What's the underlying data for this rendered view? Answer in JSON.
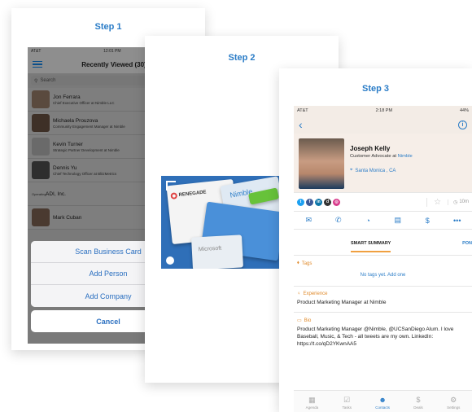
{
  "steps": {
    "step1": "Step 1",
    "step2": "Step 2",
    "step3": "Step 3"
  },
  "step1": {
    "status_carrier": "AT&T",
    "status_time": "12:01 PM",
    "title": "Recently Viewed (30)",
    "search_placeholder": "Search",
    "contacts": [
      {
        "name": "Jon Ferrara",
        "title": "Chief Executive Officer at Nimble LLC"
      },
      {
        "name": "Michaela Prouzova",
        "title": "Community Engagement Manager at Nimble"
      },
      {
        "name": "Kevin Turner",
        "title": "Strategic Partner Development at Nimble"
      },
      {
        "name": "Dennis Yu",
        "title": "Chief Technology Officer at BlitzMetrics"
      },
      {
        "name": "ADI, Inc.",
        "title": ""
      },
      {
        "name": "Mark Cuban",
        "title": ""
      }
    ],
    "section_label": "Operating",
    "sheet": {
      "scan": "Scan Business Card",
      "add_person": "Add Person",
      "add_company": "Add Company",
      "cancel": "Cancel"
    }
  },
  "step2": {
    "card_brand_1": "RENEGADE",
    "card_brand_2": "Nimble",
    "card_brand_3": "Microsoft"
  },
  "step3": {
    "status_carrier": "AT&T",
    "status_time": "2:18 PM",
    "status_battery": "44%",
    "name": "Joseph Kelly",
    "role_prefix": "Customer Advocate at",
    "company": "Nimble",
    "location": "Santa Monica , CA",
    "time_label": "10m",
    "tabs": {
      "active": "SMART SUMMARY",
      "next": "PON"
    },
    "tags_label": "Tags",
    "tags_empty": "No tags yet. Add one",
    "experience_label": "Experience",
    "experience_value": "Product Marketing Manager at Nimble",
    "bio_label": "Bio",
    "bio_text": "Product Marketing Manager @Nimble, @UCSanDiego Alum. I love Baseball, Music, & Tech - all tweets are my own. LinkedIn: https://t.co/qD2YKwnAA5",
    "tabbar": [
      "Agenda",
      "Tasks",
      "Contacts",
      "Deals",
      "Settings"
    ]
  }
}
